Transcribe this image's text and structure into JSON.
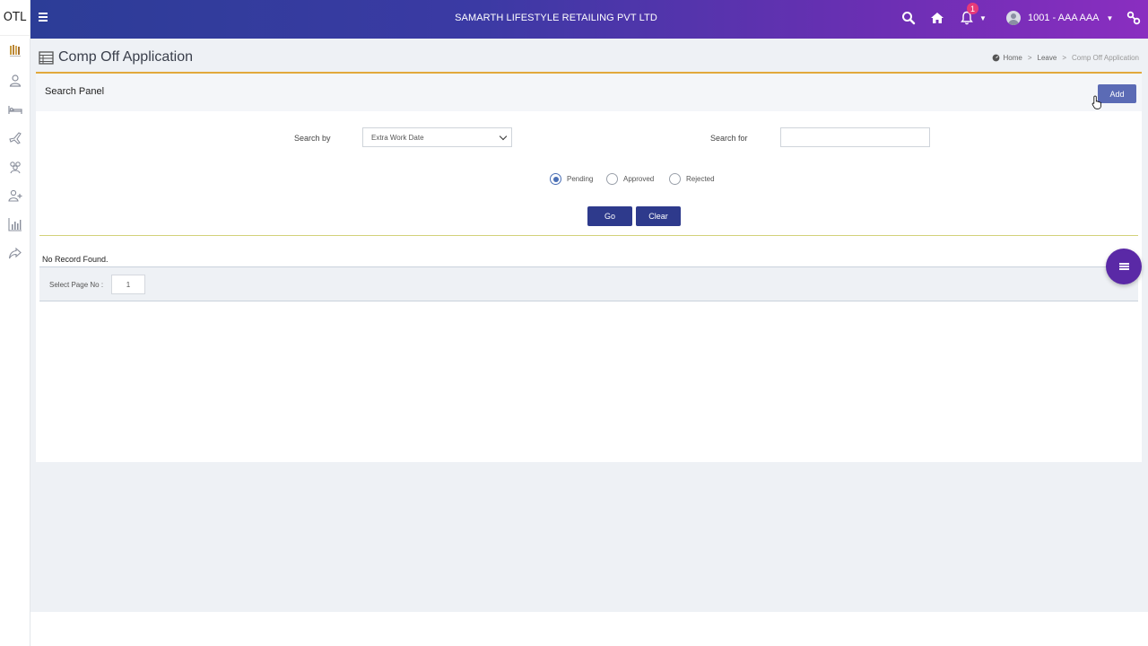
{
  "sidebar": {
    "brand": "OTL",
    "icons": [
      "logo-icon",
      "user-icon",
      "bed-icon",
      "plane-icon",
      "group-icon",
      "user-plus-icon",
      "bar-chart-icon",
      "share-icon"
    ]
  },
  "topbar": {
    "company": "SAMARTH LIFESTYLE RETAILING PVT LTD",
    "notification_count": "1",
    "user_label": "1001 - AAA AAA",
    "gradient_start": "#2c3d97",
    "gradient_end": "#8a2ec0"
  },
  "page": {
    "title": "Comp Off Application",
    "breadcrumb": {
      "home": "Home",
      "leave": "Leave",
      "current": "Comp Off Application"
    }
  },
  "search_panel": {
    "title": "Search Panel",
    "add_label": "Add",
    "search_by_label": "Search by",
    "search_by_value": "Extra Work Date",
    "search_for_label": "Search for",
    "search_for_value": "",
    "status_options": [
      {
        "label": "Pending",
        "checked": true
      },
      {
        "label": "Approved",
        "checked": false
      },
      {
        "label": "Rejected",
        "checked": false
      }
    ],
    "go_label": "Go",
    "clear_label": "Clear"
  },
  "results": {
    "message": "No Record Found.",
    "select_page_label": "Select Page No :",
    "page_no": "1"
  },
  "colors": {
    "accent": "#2e3a8c",
    "card_top_border": "#e2a93c",
    "fab": "#5a29a6"
  }
}
